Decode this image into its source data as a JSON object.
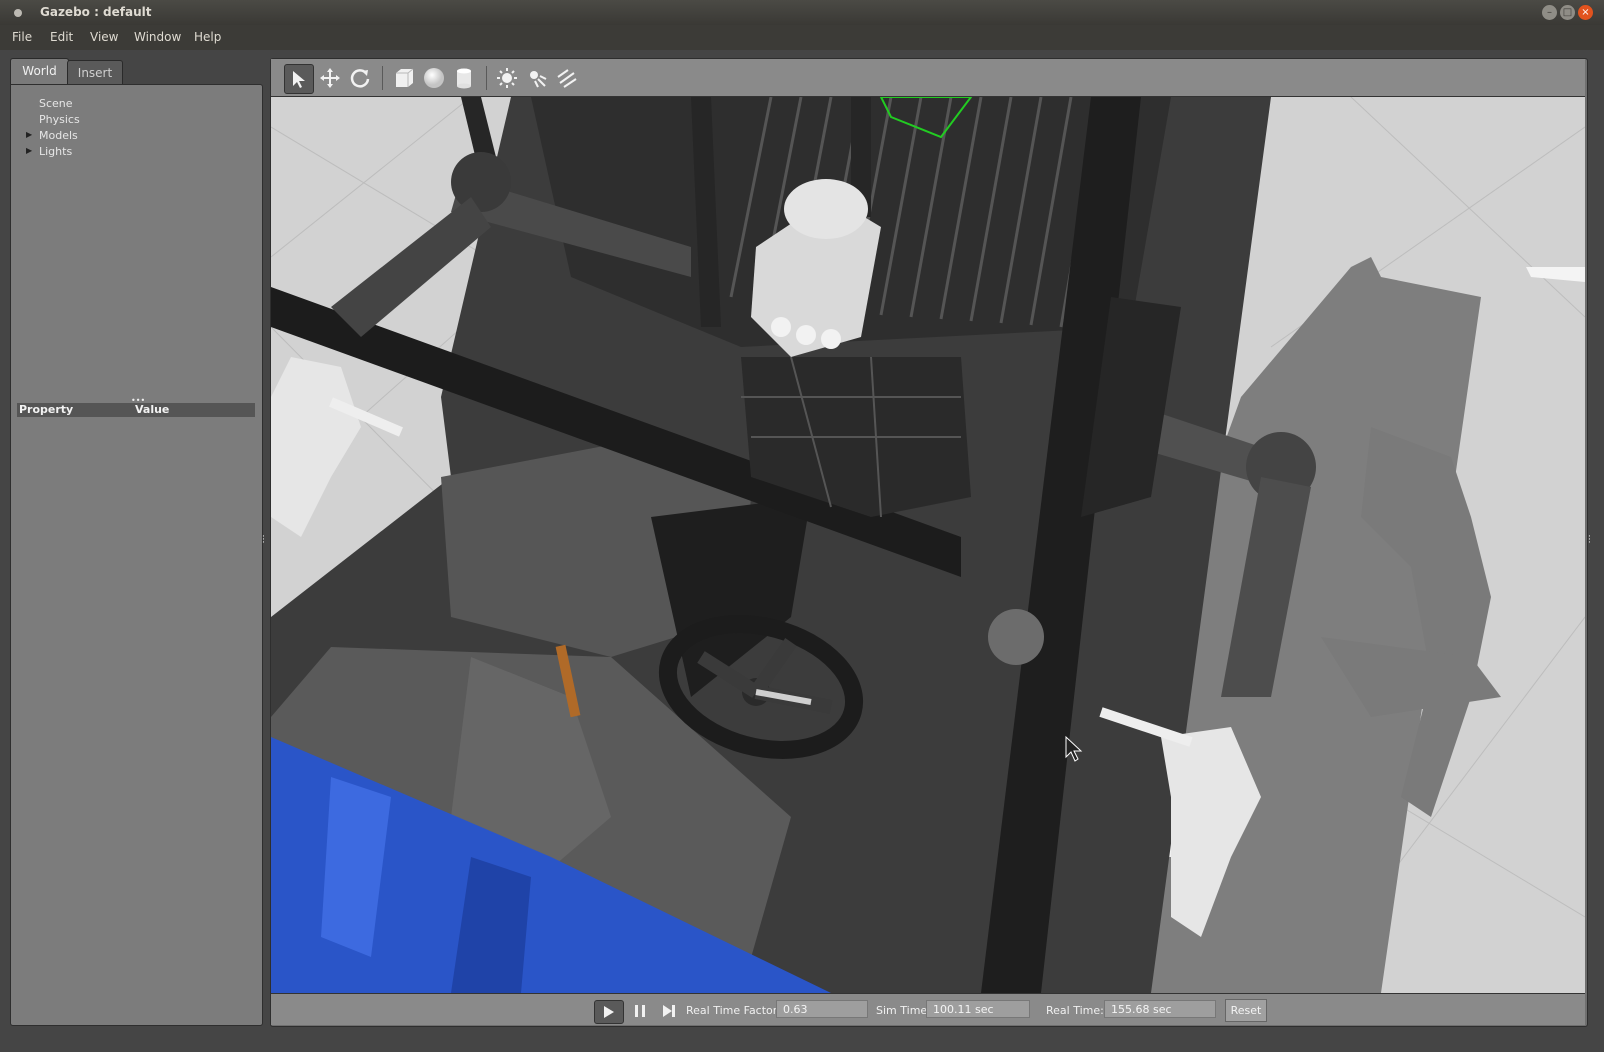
{
  "window": {
    "title": "Gazebo : default"
  },
  "menu": {
    "items": [
      "File",
      "Edit",
      "View",
      "Window",
      "Help"
    ]
  },
  "left_panel": {
    "tabs": [
      "World",
      "Insert"
    ],
    "tree": [
      "Scene",
      "Physics",
      "Models",
      "Lights"
    ],
    "property_header": {
      "property": "Property",
      "value": "Value"
    }
  },
  "toolbar": {
    "tools": [
      "select-arrow-icon",
      "translate-icon",
      "rotate-icon",
      "box-icon",
      "sphere-icon",
      "cylinder-icon",
      "point-light-icon",
      "spot-light-icon",
      "directional-light-icon"
    ]
  },
  "status": {
    "real_time_factor_label": "Real Time Factor:",
    "real_time_factor": "0.63",
    "sim_time_label": "Sim Time:",
    "sim_time": "100.11 sec",
    "real_time_label": "Real Time:",
    "real_time": "155.68 sec",
    "reset_label": "Reset"
  },
  "colors": {
    "accent_blue": "#2a55c8",
    "handle_orange": "#b06a28",
    "bounding_green": "#22cc22"
  }
}
